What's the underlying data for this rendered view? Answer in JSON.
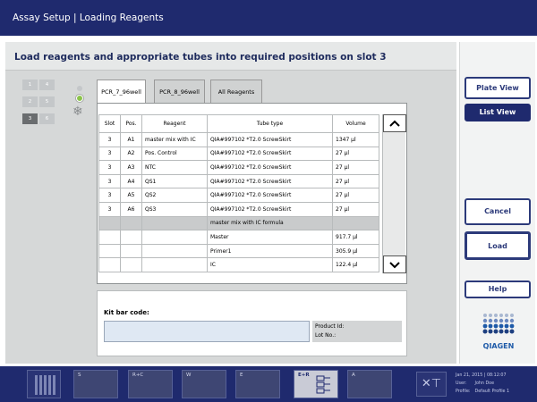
{
  "window": {
    "title": "Assay Setup | Loading Reagents"
  },
  "main": {
    "heading": "Load reagents and appropriate tubes into required positions on slot 3"
  },
  "slots": [
    {
      "label": "1",
      "active": false
    },
    {
      "label": "4",
      "active": false
    },
    {
      "label": "2",
      "active": false
    },
    {
      "label": "5",
      "active": false
    },
    {
      "label": "3",
      "active": true
    },
    {
      "label": "6",
      "active": false
    }
  ],
  "status": {
    "indicator_color": "#8bc34a",
    "cooling_icon": "snowflake-icon"
  },
  "tabs": [
    {
      "label": "PCR_7_96well",
      "active": true
    },
    {
      "label": "PCR_8_96well",
      "active": false
    },
    {
      "label": "All Reagents",
      "active": false
    }
  ],
  "table": {
    "headers": [
      "Slot",
      "Pos.",
      "Reagent",
      "Tube type",
      "Volume"
    ],
    "rows": [
      [
        "3",
        "A1",
        "master mix with IC",
        "QIA#997102 *T2.0 ScrewSkirt",
        "1347 µl"
      ],
      [
        "3",
        "A2",
        "Pos. Control",
        "QIA#997102 *T2.0 ScrewSkirt",
        "27 µl"
      ],
      [
        "3",
        "A3",
        "NTC",
        "QIA#997102 *T2.0 ScrewSkirt",
        "27 µl"
      ],
      [
        "3",
        "A4",
        "QS1",
        "QIA#997102 *T2.0 ScrewSkirt",
        "27 µl"
      ],
      [
        "3",
        "A5",
        "QS2",
        "QIA#997102 *T2.0 ScrewSkirt",
        "27 µl"
      ],
      [
        "3",
        "A6",
        "QS3",
        "QIA#997102 *T2.0 ScrewSkirt",
        "27 µl"
      ]
    ],
    "formula_header": "master mix with IC formula",
    "formula_rows": [
      [
        "Master",
        "917.7 µl"
      ],
      [
        "Primer1",
        "305.9 µl"
      ],
      [
        "IC",
        "122.4 µl"
      ]
    ],
    "scroll_up_icon": "chevron-up-icon",
    "scroll_down_icon": "chevron-down-icon"
  },
  "kit": {
    "barcode_label": "Kit bar code:",
    "barcode_value": "",
    "product_id_label": "Product Id:",
    "lot_no_label": "Lot No.:"
  },
  "right_panel": {
    "plate_view": "Plate View",
    "list_view": "List View",
    "cancel": "Cancel",
    "load": "Load",
    "help": "Help",
    "logo_text": "QIAGEN"
  },
  "bottom_bar": {
    "slots": [
      "S",
      "R+C",
      "W",
      "E",
      "E+R",
      "A"
    ],
    "tools_icon": "tools-icon",
    "status_date": "Jan 21, 2015 | 08:12:07",
    "user_label": "User:",
    "user_value": "John Doe",
    "profile_label": "Profile:",
    "profile_value": "Default Profile 1"
  },
  "colors": {
    "brand_navy": "#1f2a6e",
    "panel_gray": "#d6d8d8",
    "accent_green": "#8bc34a",
    "logo_blue": "#1e5aa8"
  }
}
